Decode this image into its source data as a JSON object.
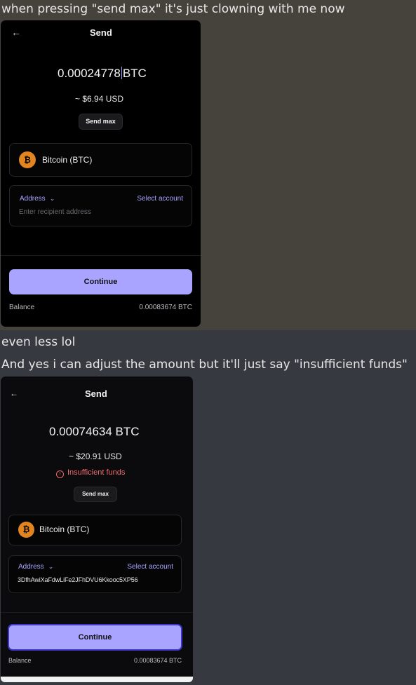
{
  "messages": {
    "first": "when pressing \"send max\" it's just clowning with me now",
    "second": "even less lol",
    "third": "And yes i can adjust the amount but it'll just say \"insufficient funds\""
  },
  "colors": {
    "accent": "#a9a4ff",
    "bitcoin": "#e2841f",
    "error": "#ef6b6b",
    "phone_bg": "#000000"
  },
  "icons": {
    "back": "←",
    "bitcoin": "₿",
    "chevron": "⌄",
    "warning": "!"
  },
  "screen_a": {
    "title": "Send",
    "amount_value": "0.00024778",
    "amount_unit": "BTC",
    "usd": "~ $6.94 USD",
    "send_max": "Send max",
    "coin_label": "Bitcoin (BTC)",
    "address_label": "Address",
    "select_account": "Select account",
    "address_placeholder": "Enter recipient address",
    "continue": "Continue",
    "balance_label": "Balance",
    "balance_value": "0.00083674 BTC"
  },
  "screen_b": {
    "title": "Send",
    "amount": "0.00074634 BTC",
    "usd": "~ $20.91 USD",
    "warning": "Insufficient funds",
    "send_max": "Send max",
    "coin_label": "Bitcoin (BTC)",
    "address_label": "Address",
    "select_account": "Select account",
    "address_value": "3DfhAwiXaFdwLiFe2JFhDVU6Kkooc5XP56",
    "continue": "Continue",
    "balance_label": "Balance",
    "balance_value": "0.00083674 BTC"
  }
}
